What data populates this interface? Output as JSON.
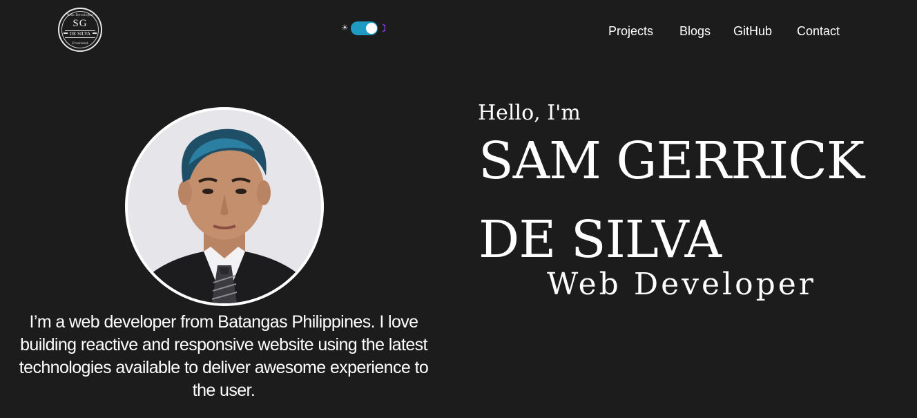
{
  "header": {
    "logo": {
      "initials": "SG",
      "name": "DE SILVA",
      "top_text": "Web Developer",
      "bottom_text": "Frontend"
    },
    "theme_toggle": {
      "state": "dark",
      "light_icon": "sun-icon",
      "dark_icon": "moon-icon",
      "accent_color": "#1e9ac3",
      "moon_color": "#8a3dd6"
    },
    "nav": [
      {
        "label": "Projects"
      },
      {
        "label": "Blogs"
      },
      {
        "label": "GitHub"
      },
      {
        "label": "Contact"
      }
    ]
  },
  "hero": {
    "greeting": "Hello, I'm",
    "name_line1": "SAM GERRICK",
    "name_line2": "DE SILVA",
    "role": "Web Developer",
    "bio": "I’m a web developer from Batangas Philippines. I love building reactive and responsive website using the latest technologies available to deliver awesome experience to the user."
  },
  "colors": {
    "background": "#1c1c1c",
    "text": "#ffffff"
  }
}
